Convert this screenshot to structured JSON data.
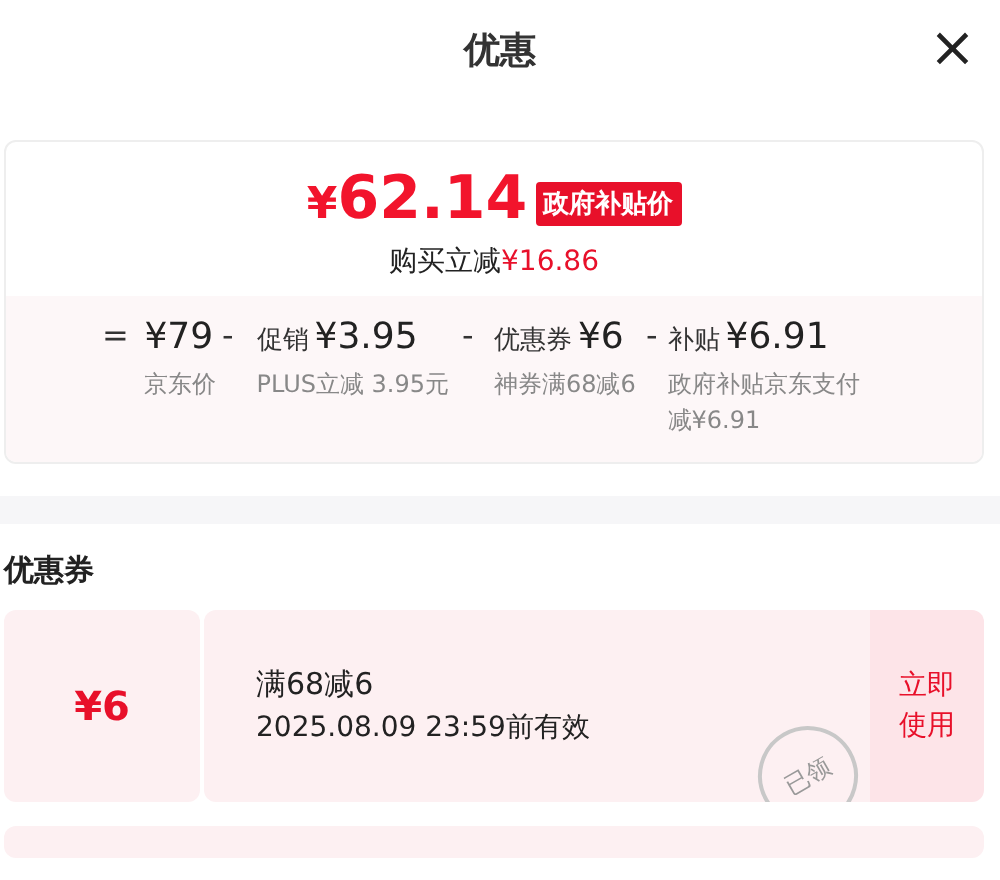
{
  "header": {
    "title": "优惠",
    "close": "×"
  },
  "price": {
    "amount": "¥62.14",
    "tag": "政府补贴价",
    "discount_label": "购买立减",
    "discount_amount": "¥16.86"
  },
  "breakdown": [
    {
      "sign": "=",
      "amount": "¥79",
      "note": "京东价"
    },
    {
      "sign": "-",
      "label": "促销",
      "amount": "¥3.95",
      "note": "PLUS立减 3.95元"
    },
    {
      "sign": "-",
      "label": "优惠券",
      "amount": "¥6",
      "note": "神券满68减6"
    },
    {
      "sign": "-",
      "label": "补贴",
      "amount": "¥6.91",
      "note": "政府补贴京东支付减¥6.91"
    }
  ],
  "coupons_section": {
    "title": "优惠券"
  },
  "coupons": [
    {
      "value": "¥6",
      "title": "满68减6",
      "validity": "2025.08.09 23:59前有效",
      "action": "立即使用",
      "stamp": "已领"
    }
  ]
}
